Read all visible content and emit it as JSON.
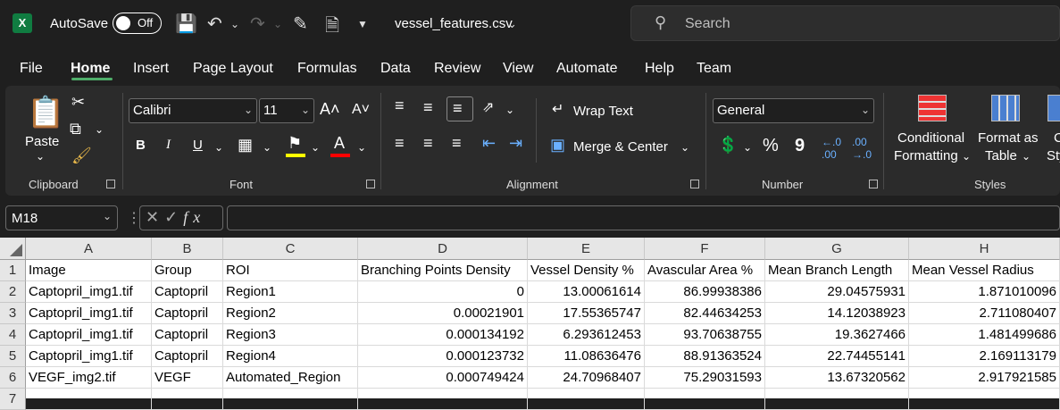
{
  "titlebar": {
    "autosave_label": "AutoSave",
    "toggle_state": "Off",
    "filename": "vessel_features.csv",
    "search_placeholder": "Search"
  },
  "tabs": [
    "File",
    "Home",
    "Insert",
    "Page Layout",
    "Formulas",
    "Data",
    "Review",
    "View",
    "Automate",
    "Help",
    "Team"
  ],
  "active_tab": "Home",
  "ribbon": {
    "clipboard": {
      "paste_label": "Paste",
      "group_label": "Clipboard"
    },
    "font": {
      "font_name": "Calibri",
      "font_size": "11",
      "group_label": "Font",
      "bold": "B",
      "italic": "I",
      "underline": "U"
    },
    "alignment": {
      "wrap_text": "Wrap Text",
      "merge_center": "Merge & Center",
      "group_label": "Alignment"
    },
    "number": {
      "format": "General",
      "group_label": "Number",
      "percent": "%",
      "comma": "9"
    },
    "styles": {
      "conditional_line1": "Conditional",
      "conditional_line2": "Formatting",
      "format_table_line1": "Format as",
      "format_table_line2": "Table",
      "cell_styles_line1": "C",
      "cell_styles_line2": "Sty",
      "group_label": "Styles"
    }
  },
  "formula_bar": {
    "name_box": "M18",
    "formula": ""
  },
  "columns": [
    "A",
    "B",
    "C",
    "D",
    "E",
    "F",
    "G",
    "H"
  ],
  "rows": [
    [
      "Image",
      "Group",
      "ROI",
      "Branching Points Density",
      "Vessel Density %",
      "Avascular Area %",
      "Mean Branch Length",
      "Mean Vessel Radius"
    ],
    [
      "Captopril_img1.tif",
      "Captopril",
      "Region1",
      "0",
      "13.00061614",
      "86.99938386",
      "29.04575931",
      "1.871010096"
    ],
    [
      "Captopril_img1.tif",
      "Captopril",
      "Region2",
      "0.00021901",
      "17.55365747",
      "82.44634253",
      "14.12038923",
      "2.711080407"
    ],
    [
      "Captopril_img1.tif",
      "Captopril",
      "Region3",
      "0.000134192",
      "6.293612453",
      "93.70638755",
      "19.3627466",
      "1.481499686"
    ],
    [
      "Captopril_img1.tif",
      "Captopril",
      "Region4",
      "0.000123732",
      "11.08636476",
      "88.91363524",
      "22.74455141",
      "2.169113179"
    ],
    [
      "VEGF_img2.tif",
      "VEGF",
      "Automated_Region",
      "0.000749424",
      "24.70968407",
      "75.29031593",
      "13.67320562",
      "2.917921585"
    ],
    [
      "",
      "",
      "",
      "",
      "",
      "",
      "",
      ""
    ]
  ],
  "row_numbers": [
    "1",
    "2",
    "3",
    "4",
    "5",
    "6",
    "7"
  ],
  "colors": {
    "accent": "#4fae6a",
    "excel_green": "#107c41",
    "chrome_bg": "#1f1f1f",
    "ribbon_bg": "#2b2b2b"
  }
}
